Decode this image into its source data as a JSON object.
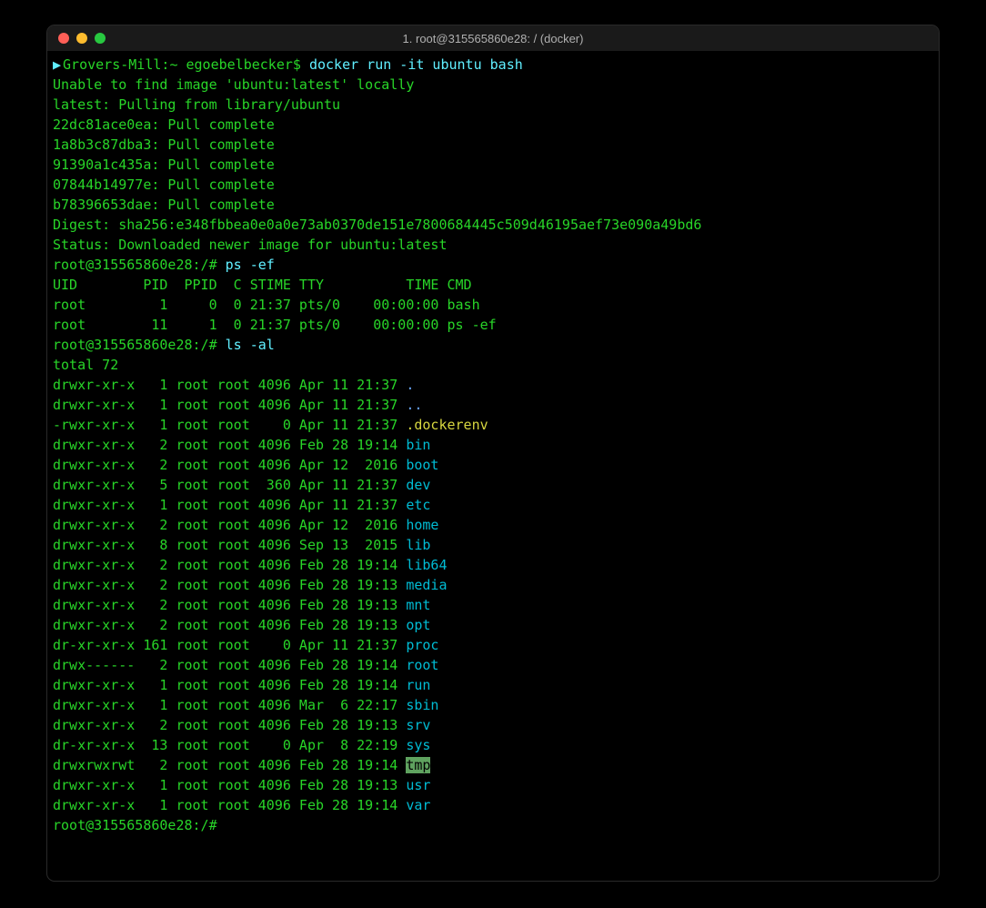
{
  "window": {
    "title": "1. root@315565860e28: / (docker)"
  },
  "prompt1": {
    "host": "Grovers-Mill",
    "path": "~",
    "user": "egoebelbecker",
    "cmd": "docker run -it ubuntu bash"
  },
  "pull": {
    "l1": "Unable to find image 'ubuntu:latest' locally",
    "l2": "latest: Pulling from library/ubuntu",
    "layers": [
      "22dc81ace0ea: Pull complete ",
      "1a8b3c87dba3: Pull complete ",
      "91390a1c435a: Pull complete ",
      "07844b14977e: Pull complete ",
      "b78396653dae: Pull complete "
    ],
    "digest": "Digest: sha256:e348fbbea0e0a0e73ab0370de151e7800684445c509d46195aef73e090a49bd6",
    "status": "Status: Downloaded newer image for ubuntu:latest"
  },
  "prompt2": {
    "text": "root@315565860e28:/# ",
    "cmd": "ps -ef"
  },
  "ps": {
    "header": "UID        PID  PPID  C STIME TTY          TIME CMD",
    "rows": [
      "root         1     0  0 21:37 pts/0    00:00:00 bash",
      "root        11     1  0 21:37 pts/0    00:00:00 ps -ef"
    ]
  },
  "prompt3": {
    "text": "root@315565860e28:/# ",
    "cmd": "ls -al"
  },
  "ls": {
    "total": "total 72",
    "rows": [
      {
        "meta": "drwxr-xr-x   1 root root 4096 Apr 11 21:37 ",
        "name": ".",
        "cls": "blue"
      },
      {
        "meta": "drwxr-xr-x   1 root root 4096 Apr 11 21:37 ",
        "name": "..",
        "cls": "blue"
      },
      {
        "meta": "-rwxr-xr-x   1 root root    0 Apr 11 21:37 ",
        "name": ".dockerenv",
        "cls": "yellow"
      },
      {
        "meta": "drwxr-xr-x   2 root root 4096 Feb 28 19:14 ",
        "name": "bin",
        "cls": "cyan"
      },
      {
        "meta": "drwxr-xr-x   2 root root 4096 Apr 12  2016 ",
        "name": "boot",
        "cls": "cyan"
      },
      {
        "meta": "drwxr-xr-x   5 root root  360 Apr 11 21:37 ",
        "name": "dev",
        "cls": "cyan"
      },
      {
        "meta": "drwxr-xr-x   1 root root 4096 Apr 11 21:37 ",
        "name": "etc",
        "cls": "cyan"
      },
      {
        "meta": "drwxr-xr-x   2 root root 4096 Apr 12  2016 ",
        "name": "home",
        "cls": "cyan"
      },
      {
        "meta": "drwxr-xr-x   8 root root 4096 Sep 13  2015 ",
        "name": "lib",
        "cls": "cyan"
      },
      {
        "meta": "drwxr-xr-x   2 root root 4096 Feb 28 19:14 ",
        "name": "lib64",
        "cls": "cyan"
      },
      {
        "meta": "drwxr-xr-x   2 root root 4096 Feb 28 19:13 ",
        "name": "media",
        "cls": "cyan"
      },
      {
        "meta": "drwxr-xr-x   2 root root 4096 Feb 28 19:13 ",
        "name": "mnt",
        "cls": "cyan"
      },
      {
        "meta": "drwxr-xr-x   2 root root 4096 Feb 28 19:13 ",
        "name": "opt",
        "cls": "cyan"
      },
      {
        "meta": "dr-xr-xr-x 161 root root    0 Apr 11 21:37 ",
        "name": "proc",
        "cls": "cyan"
      },
      {
        "meta": "drwx------   2 root root 4096 Feb 28 19:14 ",
        "name": "root",
        "cls": "cyan"
      },
      {
        "meta": "drwxr-xr-x   1 root root 4096 Feb 28 19:14 ",
        "name": "run",
        "cls": "cyan"
      },
      {
        "meta": "drwxr-xr-x   1 root root 4096 Mar  6 22:17 ",
        "name": "sbin",
        "cls": "cyan"
      },
      {
        "meta": "drwxr-xr-x   2 root root 4096 Feb 28 19:13 ",
        "name": "srv",
        "cls": "cyan"
      },
      {
        "meta": "dr-xr-xr-x  13 root root    0 Apr  8 22:19 ",
        "name": "sys",
        "cls": "cyan"
      },
      {
        "meta": "drwxrwxrwt   2 root root 4096 Feb 28 19:14 ",
        "name": "tmp",
        "cls": "tmp"
      },
      {
        "meta": "drwxr-xr-x   1 root root 4096 Feb 28 19:13 ",
        "name": "usr",
        "cls": "cyan"
      },
      {
        "meta": "drwxr-xr-x   1 root root 4096 Feb 28 19:14 ",
        "name": "var",
        "cls": "cyan"
      }
    ]
  },
  "prompt4": {
    "text": "root@315565860e28:/# "
  }
}
